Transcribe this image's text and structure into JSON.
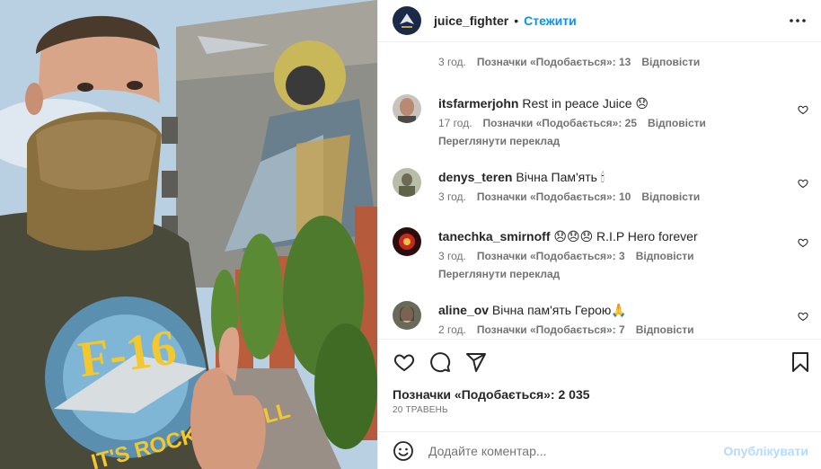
{
  "header": {
    "username": "juice_fighter",
    "dot": "•",
    "follow_label": "Стежити"
  },
  "comments": [
    {
      "username": "",
      "text": "",
      "time": "3 год.",
      "likes": "Позначки «Подобається»: 13",
      "reply": "Відповісти",
      "translate": ""
    },
    {
      "username": "itsfarmerjohn",
      "text": "Rest in peace Juice 😞",
      "time": "17 год.",
      "likes": "Позначки «Подобається»: 25",
      "reply": "Відповісти",
      "translate": "Переглянути переклад"
    },
    {
      "username": "denys_teren",
      "text": "Вічна Пам'ять 🕯",
      "time": "3 год.",
      "likes": "Позначки «Подобається»: 10",
      "reply": "Відповісти",
      "translate": ""
    },
    {
      "username": "tanechka_smirnoff",
      "text": "😞😞😞 R.I.P Hero forever",
      "time": "3 год.",
      "likes": "Позначки «Подобається»: 3",
      "reply": "Відповісти",
      "translate": "Переглянути переклад"
    },
    {
      "username": "aline_ov",
      "text": "Вічна пам'ять Герою🙏",
      "time": "2 год.",
      "likes": "Позначки «Подобається»: 7",
      "reply": "Відповісти",
      "translate": ""
    }
  ],
  "footer": {
    "likes": "Позначки «Подобається»: 2 035",
    "date": "20 ТРАВЕНЬ",
    "comment_placeholder": "Додайте коментар...",
    "publish_label": "Опублікувати"
  },
  "photo": {
    "shirt_text": "F-16",
    "shirt_slogan": "IT'S ROCK 'N' ROLL"
  },
  "colors": {
    "accent": "#0095f6",
    "publish_disabled": "#b3dbff",
    "muted": "#737373"
  },
  "icons": [
    "more-icon",
    "heart-icon",
    "comment-icon",
    "share-icon",
    "bookmark-icon",
    "emoji-icon"
  ]
}
